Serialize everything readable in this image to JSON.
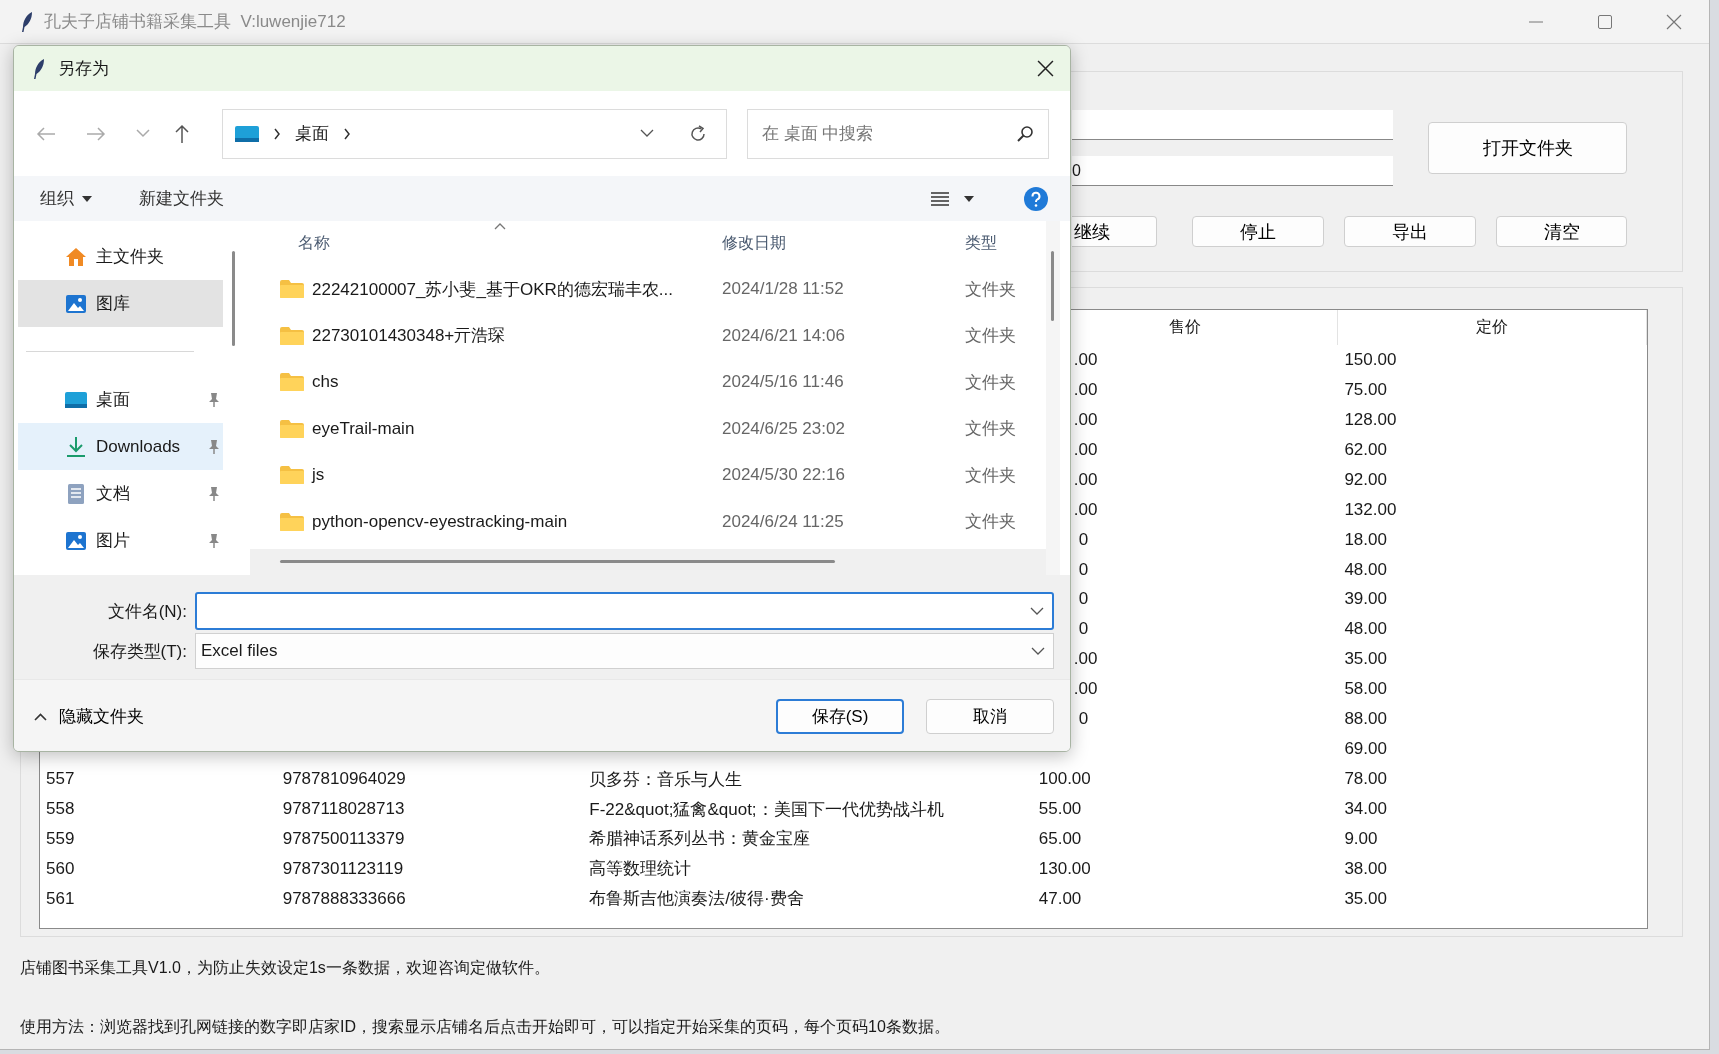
{
  "window": {
    "title": "孔夫子店铺书籍采集工具  V:luwenjie712"
  },
  "page_field": {
    "value": "0"
  },
  "open_folder_button": "打开文件夹",
  "action_buttons": [
    "继续",
    "停止",
    "导出",
    "清空"
  ],
  "table": {
    "visible_columns": [
      "售价",
      "定价"
    ],
    "rows": [
      {
        "cells": [
          null,
          null,
          null,
          ".00",
          "150.00"
        ]
      },
      {
        "cells": [
          null,
          null,
          null,
          ".00",
          "75.00"
        ]
      },
      {
        "cells": [
          null,
          null,
          null,
          ".00",
          "128.00"
        ]
      },
      {
        "cells": [
          null,
          null,
          null,
          ".00",
          "62.00"
        ]
      },
      {
        "cells": [
          null,
          null,
          null,
          ".00",
          "92.00"
        ]
      },
      {
        "cells": [
          null,
          null,
          null,
          ".00",
          "132.00"
        ]
      },
      {
        "cells": [
          null,
          null,
          null,
          "0",
          "18.00"
        ]
      },
      {
        "cells": [
          null,
          null,
          null,
          "0",
          "48.00"
        ]
      },
      {
        "cells": [
          null,
          null,
          null,
          "0",
          "39.00"
        ]
      },
      {
        "cells": [
          null,
          null,
          null,
          "0",
          "48.00"
        ]
      },
      {
        "cells": [
          null,
          null,
          null,
          ".00",
          "35.00"
        ]
      },
      {
        "cells": [
          null,
          null,
          null,
          ".00",
          "58.00"
        ]
      },
      {
        "cells": [
          null,
          null,
          null,
          "0",
          "88.00"
        ]
      },
      {
        "cells": [
          null,
          null,
          null,
          null,
          "69.00"
        ]
      },
      {
        "cells": [
          "557",
          "9787810964029",
          "贝多芬：音乐与人生",
          "100.00",
          "78.00"
        ]
      },
      {
        "cells": [
          "558",
          "9787118028713",
          "F-22&quot;猛禽&quot;：美国下一代优势战斗机",
          "55.00",
          "34.00"
        ]
      },
      {
        "cells": [
          "559",
          "9787500113379",
          "希腊神话系列丛书：黄金宝座",
          "65.00",
          "9.00"
        ]
      },
      {
        "cells": [
          "560",
          "9787301123119",
          "高等数理统计",
          "130.00",
          "38.00"
        ]
      },
      {
        "cells": [
          "561",
          "9787888333666",
          "布鲁斯吉他演奏法/彼得·费舍",
          "47.00",
          "35.00"
        ]
      }
    ]
  },
  "notes": [
    "店铺图书采集工具V1.0，为防止失效设定1s一条数据，欢迎咨询定做软件。",
    "使用方法：浏览器找到孔网链接的数字即店家ID，搜索显示店铺名后点击开始即可，可以指定开始采集的页码，每个页码10条数据。"
  ],
  "dialog": {
    "title": "另存为",
    "address": {
      "crumbs": [
        "桌面"
      ]
    },
    "search": {
      "placeholder": "在 桌面 中搜索"
    },
    "toolbar": {
      "organize": "组织",
      "new_folder": "新建文件夹"
    },
    "sidebar": {
      "groups": [
        [
          {
            "label": "主文件夹",
            "selected": false,
            "highlighted": false,
            "pinned": false
          },
          {
            "label": "图库",
            "selected": true,
            "highlighted": false,
            "pinned": false
          }
        ],
        [
          {
            "label": "桌面",
            "selected": false,
            "highlighted": false,
            "pinned": true
          },
          {
            "label": "Downloads",
            "selected": false,
            "highlighted": true,
            "pinned": true
          },
          {
            "label": "文档",
            "selected": false,
            "highlighted": false,
            "pinned": true
          },
          {
            "label": "图片",
            "selected": false,
            "highlighted": false,
            "pinned": true
          }
        ]
      ]
    },
    "file_list": {
      "columns": [
        "名称",
        "修改日期",
        "类型"
      ],
      "rows": [
        {
          "name": "22242100007_苏小斐_基于OKR的德宏瑞丰农...",
          "date": "2024/1/28 11:52",
          "type": "文件夹"
        },
        {
          "name": "22730101430348+亓浩琛",
          "date": "2024/6/21 14:06",
          "type": "文件夹"
        },
        {
          "name": "chs",
          "date": "2024/5/16 11:46",
          "type": "文件夹"
        },
        {
          "name": "eyeTrail-main",
          "date": "2024/6/25 23:02",
          "type": "文件夹"
        },
        {
          "name": "js",
          "date": "2024/5/30 22:16",
          "type": "文件夹"
        },
        {
          "name": "python-opencv-eyestracking-main",
          "date": "2024/6/24 11:25",
          "type": "文件夹"
        }
      ]
    },
    "filename": {
      "label": "文件名(N):"
    },
    "filetype": {
      "label": "保存类型(T):",
      "value": "Excel files"
    },
    "hide_folders": "隐藏文件夹",
    "buttons": [
      {
        "label": "保存(S)",
        "default": true
      },
      {
        "label": "取消",
        "default": false
      }
    ]
  }
}
